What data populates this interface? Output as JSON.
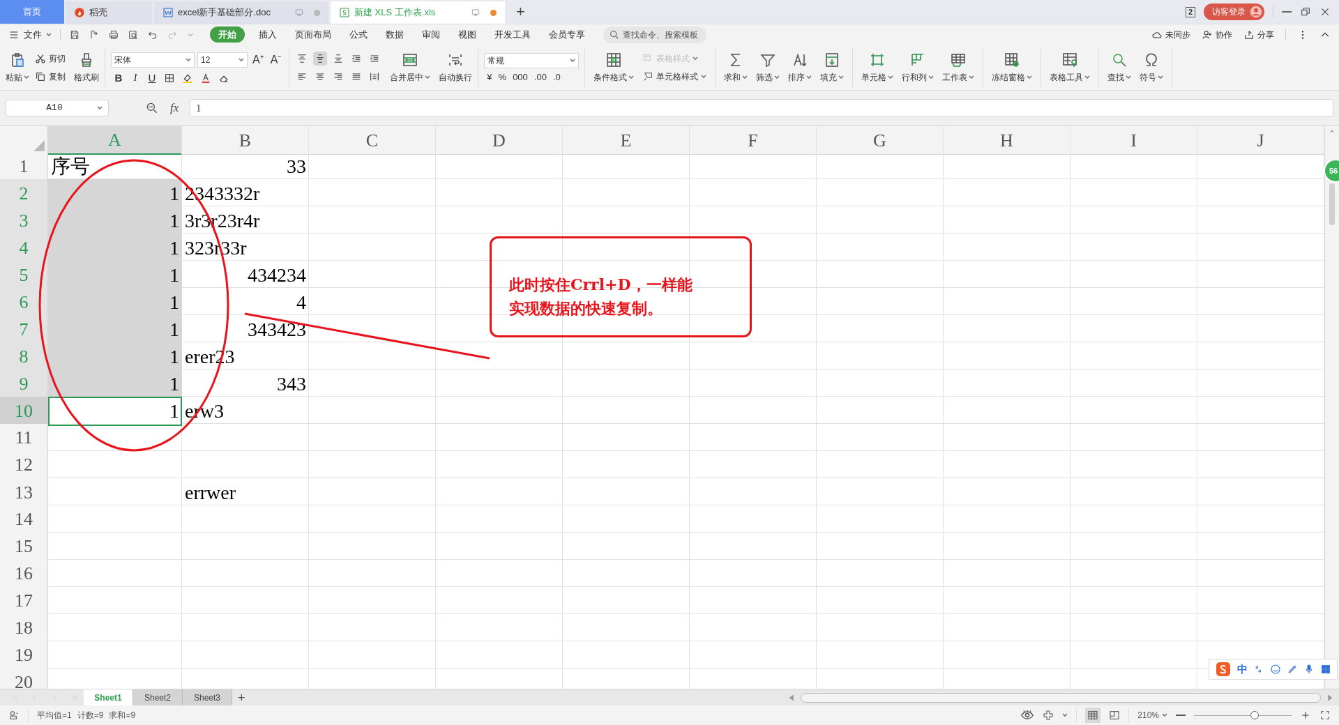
{
  "tabs": [
    {
      "kind": "home",
      "label": "首页",
      "selected": false
    },
    {
      "kind": "docer",
      "label": "稻壳",
      "selected": false
    },
    {
      "kind": "doc",
      "label": "excel新手基础部分.doc",
      "selected": false,
      "unsaved": false
    },
    {
      "kind": "sheet",
      "label": "新建 XLS 工作表.xls",
      "selected": true,
      "unsaved": true
    }
  ],
  "new_tab": "+",
  "window": {
    "page_count": "2",
    "login": "访客登录"
  },
  "menu": {
    "file": "文件",
    "items": [
      {
        "label": "开始",
        "selected": true
      },
      {
        "label": "插入",
        "selected": false
      },
      {
        "label": "页面布局",
        "selected": false
      },
      {
        "label": "公式",
        "selected": false
      },
      {
        "label": "数据",
        "selected": false
      },
      {
        "label": "审阅",
        "selected": false
      },
      {
        "label": "视图",
        "selected": false
      },
      {
        "label": "开发工具",
        "selected": false
      },
      {
        "label": "会员专享",
        "selected": false
      }
    ],
    "search": {
      "placeholder": "查找命令、搜索模板"
    },
    "actions": [
      "未同步",
      "协作",
      "分享"
    ]
  },
  "ribbon": {
    "clipboard": {
      "paste": "粘贴",
      "cut": "剪切",
      "copy": "复制",
      "painter": "格式刷"
    },
    "font": {
      "name": "宋体",
      "size": "12",
      "size_buttons": [
        "A⁺",
        "A⁻"
      ],
      "style_buttons": [
        "B",
        "I",
        "U"
      ]
    },
    "alignment": {
      "merge": "合并居中",
      "wrap": "自动换行"
    },
    "number": {
      "format": "常规",
      "buttons": [
        "¥",
        "%",
        "000",
        ".00",
        ".0"
      ]
    },
    "tool_groups": [
      [
        {
          "kind": "large",
          "label": "条件格式",
          "disabled": false
        },
        {
          "kind": "small",
          "label": "表格样式",
          "disabled": true
        },
        {
          "kind": "small",
          "label": "单元格样式",
          "disabled": false
        }
      ],
      [
        {
          "kind": "large",
          "label": "求和",
          "disabled": false
        },
        {
          "kind": "large",
          "label": "筛选",
          "disabled": false
        },
        {
          "kind": "large",
          "label": "排序",
          "disabled": false
        },
        {
          "kind": "large",
          "label": "填充",
          "disabled": false
        }
      ],
      [
        {
          "kind": "large",
          "label": "单元格",
          "disabled": false
        },
        {
          "kind": "large",
          "label": "行和列",
          "disabled": false
        },
        {
          "kind": "large",
          "label": "工作表",
          "disabled": false
        }
      ],
      [
        {
          "kind": "large",
          "label": "冻结窗格",
          "disabled": false
        }
      ],
      [
        {
          "kind": "large",
          "label": "表格工具",
          "disabled": false
        }
      ],
      [
        {
          "kind": "large",
          "label": "查找",
          "disabled": false
        },
        {
          "kind": "large",
          "label": "符号",
          "disabled": false
        }
      ]
    ]
  },
  "formula_bar": {
    "name_box": "A10",
    "fx": "fx",
    "value": "1"
  },
  "columns": [
    {
      "label": "A",
      "selected": true
    },
    {
      "label": "B",
      "selected": false
    },
    {
      "label": "C",
      "selected": false
    },
    {
      "label": "D",
      "selected": false
    },
    {
      "label": "E",
      "selected": false
    },
    {
      "label": "F",
      "selected": false
    },
    {
      "label": "G",
      "selected": false
    },
    {
      "label": "H",
      "selected": false
    },
    {
      "label": "I",
      "selected": false
    },
    {
      "label": "J",
      "selected": false
    }
  ],
  "rows": [
    {
      "label": "1",
      "selected": false,
      "active": false,
      "cells": [
        {
          "text": "序号",
          "kind": "text"
        },
        {
          "text": "33",
          "kind": "number"
        }
      ]
    },
    {
      "label": "2",
      "selected": true,
      "active": false,
      "cells": [
        {
          "text": "1",
          "kind": "number"
        },
        {
          "text": "2343332r",
          "kind": "text"
        }
      ]
    },
    {
      "label": "3",
      "selected": true,
      "active": false,
      "cells": [
        {
          "text": "1",
          "kind": "number"
        },
        {
          "text": "3r3r23r4r",
          "kind": "text"
        }
      ]
    },
    {
      "label": "4",
      "selected": true,
      "active": false,
      "cells": [
        {
          "text": "1",
          "kind": "number"
        },
        {
          "text": "323r33r",
          "kind": "text"
        }
      ]
    },
    {
      "label": "5",
      "selected": true,
      "active": false,
      "cells": [
        {
          "text": "1",
          "kind": "number"
        },
        {
          "text": "434234",
          "kind": "number"
        }
      ]
    },
    {
      "label": "6",
      "selected": true,
      "active": false,
      "cells": [
        {
          "text": "1",
          "kind": "number"
        },
        {
          "text": "4",
          "kind": "number"
        }
      ]
    },
    {
      "label": "7",
      "selected": true,
      "active": false,
      "cells": [
        {
          "text": "1",
          "kind": "number"
        },
        {
          "text": "343423",
          "kind": "number"
        }
      ]
    },
    {
      "label": "8",
      "selected": true,
      "active": false,
      "cells": [
        {
          "text": "1",
          "kind": "number"
        },
        {
          "text": "erer23",
          "kind": "text"
        }
      ]
    },
    {
      "label": "9",
      "selected": true,
      "active": false,
      "cells": [
        {
          "text": "1",
          "kind": "number"
        },
        {
          "text": "343",
          "kind": "number"
        }
      ]
    },
    {
      "label": "10",
      "selected": true,
      "active": true,
      "cells": [
        {
          "text": "1",
          "kind": "number"
        },
        {
          "text": "erw3",
          "kind": "text"
        }
      ]
    },
    {
      "label": "11",
      "selected": false,
      "active": false,
      "cells": []
    },
    {
      "label": "12",
      "selected": false,
      "active": false,
      "cells": []
    },
    {
      "label": "13",
      "selected": false,
      "active": false,
      "cells": [
        null,
        {
          "text": "errwer",
          "kind": "text"
        }
      ]
    },
    {
      "label": "14",
      "selected": false,
      "active": false,
      "cells": []
    },
    {
      "label": "15",
      "selected": false,
      "active": false,
      "cells": []
    },
    {
      "label": "16",
      "selected": false,
      "active": false,
      "cells": []
    },
    {
      "label": "17",
      "selected": false,
      "active": false,
      "cells": []
    },
    {
      "label": "18",
      "selected": false,
      "active": false,
      "cells": []
    },
    {
      "label": "19",
      "selected": false,
      "active": false,
      "cells": []
    },
    {
      "label": "20",
      "selected": false,
      "active": false,
      "cells": []
    }
  ],
  "annotation": {
    "lines": [
      "此时按住Crrl+D，一样能",
      "实现数据的快速复制。"
    ]
  },
  "side_badge": "56",
  "ime": {
    "mode": "中"
  },
  "sheets": [
    {
      "label": "Sheet1",
      "selected": true
    },
    {
      "label": "Sheet2",
      "selected": false
    },
    {
      "label": "Sheet3",
      "selected": false
    }
  ],
  "add_sheet": "+",
  "status": {
    "stats": [
      "平均值=1",
      "计数=9",
      "求和=9"
    ],
    "zoom": "210%",
    "zoom_slider": {
      "level": 0.62
    }
  }
}
